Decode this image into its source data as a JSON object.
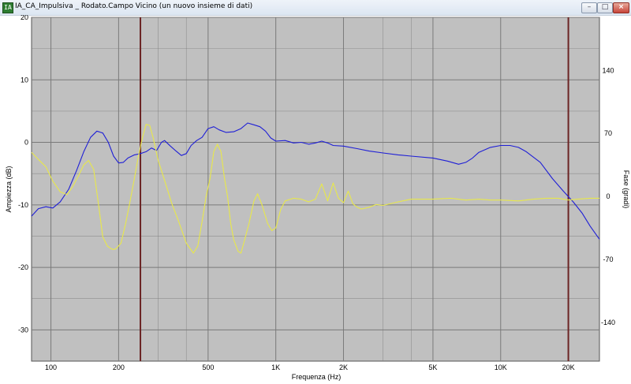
{
  "window": {
    "title": "IA_CA_Impulsiva _ Rodato.Campo Vicino (un nuovo insieme di dati)",
    "app_icon_label": "IA",
    "buttons": {
      "minimize": "–",
      "maximize": "□",
      "close": "×"
    }
  },
  "chart_data": {
    "type": "line",
    "xlabel": "Frequenza (Hz)",
    "ylabel": "Ampiezza (dB)",
    "y2label": "Fase (gradi)",
    "xscale": "log",
    "xlim": [
      82,
      27500
    ],
    "ylim": [
      -35,
      20
    ],
    "y2lim": [
      -183,
      199
    ],
    "grid": true,
    "plot_background": "#c0c0c0",
    "grid_color": "#7a7a7a",
    "marker_color": "#6b2424",
    "x_ticks": [
      {
        "value": 100,
        "label": "100"
      },
      {
        "value": 200,
        "label": "200"
      },
      {
        "value": 500,
        "label": "500"
      },
      {
        "value": 1000,
        "label": "1K"
      },
      {
        "value": 2000,
        "label": "2K"
      },
      {
        "value": 5000,
        "label": "5K"
      },
      {
        "value": 10000,
        "label": "10K"
      },
      {
        "value": 20000,
        "label": "20K"
      }
    ],
    "x_minor_grid": [
      300,
      400,
      3000,
      4000
    ],
    "y_ticks": [
      {
        "value": 20,
        "label": "20"
      },
      {
        "value": 10,
        "label": "10"
      },
      {
        "value": 0,
        "label": "0"
      },
      {
        "value": -10,
        "label": "-10"
      },
      {
        "value": -20,
        "label": "-20"
      },
      {
        "value": -30,
        "label": "-30"
      }
    ],
    "y_minor_grid": [
      15,
      5,
      -5,
      -15,
      -25
    ],
    "y2_ticks": [
      {
        "value": 140,
        "label": "140"
      },
      {
        "value": 70,
        "label": "70"
      },
      {
        "value": 0,
        "label": "0"
      },
      {
        "value": -70,
        "label": "-70"
      },
      {
        "value": -140,
        "label": "-140"
      }
    ],
    "markers": [
      250,
      20000
    ],
    "series": [
      {
        "axis": "left",
        "color": "#1f1fd6",
        "points": [
          [
            82,
            -11.8
          ],
          [
            88,
            -10.6
          ],
          [
            95,
            -10.3
          ],
          [
            102,
            -10.5
          ],
          [
            110,
            -9.5
          ],
          [
            120,
            -7.5
          ],
          [
            130,
            -4.5
          ],
          [
            140,
            -1.5
          ],
          [
            150,
            0.8
          ],
          [
            160,
            1.8
          ],
          [
            170,
            1.5
          ],
          [
            180,
            0
          ],
          [
            190,
            -2.2
          ],
          [
            200,
            -3.3
          ],
          [
            210,
            -3.2
          ],
          [
            220,
            -2.5
          ],
          [
            235,
            -2
          ],
          [
            250,
            -1.8
          ],
          [
            265,
            -1.5
          ],
          [
            280,
            -0.9
          ],
          [
            295,
            -1.3
          ],
          [
            310,
            0
          ],
          [
            320,
            0.3
          ],
          [
            340,
            -0.6
          ],
          [
            360,
            -1.4
          ],
          [
            380,
            -2.1
          ],
          [
            400,
            -1.8
          ],
          [
            420,
            -0.5
          ],
          [
            445,
            0.3
          ],
          [
            470,
            0.8
          ],
          [
            500,
            2.2
          ],
          [
            530,
            2.5
          ],
          [
            560,
            2.0
          ],
          [
            600,
            1.6
          ],
          [
            650,
            1.7
          ],
          [
            700,
            2.2
          ],
          [
            750,
            3.1
          ],
          [
            800,
            2.8
          ],
          [
            850,
            2.5
          ],
          [
            900,
            1.8
          ],
          [
            950,
            0.7
          ],
          [
            1000,
            0.2
          ],
          [
            1100,
            0.3
          ],
          [
            1200,
            -0.1
          ],
          [
            1300,
            0
          ],
          [
            1400,
            -0.3
          ],
          [
            1500,
            -0.1
          ],
          [
            1600,
            0.2
          ],
          [
            1700,
            -0.1
          ],
          [
            1800,
            -0.5
          ],
          [
            2000,
            -0.6
          ],
          [
            2300,
            -1
          ],
          [
            2600,
            -1.4
          ],
          [
            3000,
            -1.7
          ],
          [
            3500,
            -2
          ],
          [
            4000,
            -2.2
          ],
          [
            5000,
            -2.5
          ],
          [
            5800,
            -3
          ],
          [
            6500,
            -3.5
          ],
          [
            7000,
            -3.2
          ],
          [
            7500,
            -2.5
          ],
          [
            8000,
            -1.6
          ],
          [
            9000,
            -0.8
          ],
          [
            10000,
            -0.5
          ],
          [
            11000,
            -0.5
          ],
          [
            12000,
            -0.8
          ],
          [
            13000,
            -1.5
          ],
          [
            15000,
            -3.2
          ],
          [
            17000,
            -5.8
          ],
          [
            19000,
            -7.8
          ],
          [
            21000,
            -9.5
          ],
          [
            23000,
            -11.3
          ],
          [
            25000,
            -13.4
          ],
          [
            27500,
            -15.5
          ]
        ]
      },
      {
        "axis": "right",
        "color": "#e8e84a",
        "points": [
          [
            82,
            49
          ],
          [
            88,
            41
          ],
          [
            95,
            33
          ],
          [
            102,
            17
          ],
          [
            110,
            5
          ],
          [
            118,
            2
          ],
          [
            125,
            11
          ],
          [
            132,
            22
          ],
          [
            140,
            35
          ],
          [
            147,
            40
          ],
          [
            155,
            30
          ],
          [
            162,
            -5
          ],
          [
            170,
            -45
          ],
          [
            178,
            -55
          ],
          [
            185,
            -58
          ],
          [
            190,
            -59
          ],
          [
            195,
            -58
          ],
          [
            205,
            -52
          ],
          [
            215,
            -30
          ],
          [
            225,
            -5
          ],
          [
            235,
            20
          ],
          [
            245,
            45
          ],
          [
            255,
            65
          ],
          [
            265,
            80
          ],
          [
            275,
            79
          ],
          [
            285,
            65
          ],
          [
            300,
            40
          ],
          [
            320,
            18
          ],
          [
            345,
            -8
          ],
          [
            370,
            -28
          ],
          [
            400,
            -52
          ],
          [
            430,
            -63
          ],
          [
            450,
            -55
          ],
          [
            470,
            -28
          ],
          [
            490,
            0
          ],
          [
            510,
            20
          ],
          [
            530,
            50
          ],
          [
            550,
            58
          ],
          [
            570,
            50
          ],
          [
            590,
            22
          ],
          [
            610,
            0
          ],
          [
            630,
            -30
          ],
          [
            650,
            -48
          ],
          [
            680,
            -61
          ],
          [
            700,
            -63
          ],
          [
            720,
            -52
          ],
          [
            760,
            -30
          ],
          [
            800,
            -5
          ],
          [
            830,
            3
          ],
          [
            870,
            -10
          ],
          [
            920,
            -30
          ],
          [
            960,
            -38
          ],
          [
            1000,
            -35
          ],
          [
            1050,
            -15
          ],
          [
            1100,
            -5
          ],
          [
            1200,
            -2
          ],
          [
            1300,
            -3
          ],
          [
            1400,
            -6
          ],
          [
            1500,
            -3
          ],
          [
            1600,
            14
          ],
          [
            1700,
            -5
          ],
          [
            1800,
            15
          ],
          [
            1900,
            -2
          ],
          [
            2000,
            -7
          ],
          [
            2100,
            6
          ],
          [
            2200,
            -8
          ],
          [
            2300,
            -12
          ],
          [
            2400,
            -14
          ],
          [
            2600,
            -12
          ],
          [
            2800,
            -9
          ],
          [
            3000,
            -10
          ],
          [
            3500,
            -6
          ],
          [
            4000,
            -3
          ],
          [
            5000,
            -3
          ],
          [
            6000,
            -2
          ],
          [
            7000,
            -4
          ],
          [
            8000,
            -3
          ],
          [
            9000,
            -4
          ],
          [
            10000,
            -4
          ],
          [
            12000,
            -5
          ],
          [
            14000,
            -3
          ],
          [
            16000,
            -2
          ],
          [
            18000,
            -2
          ],
          [
            20000,
            -4
          ],
          [
            22000,
            -3
          ],
          [
            25000,
            -2
          ],
          [
            27500,
            -2
          ]
        ]
      }
    ]
  }
}
